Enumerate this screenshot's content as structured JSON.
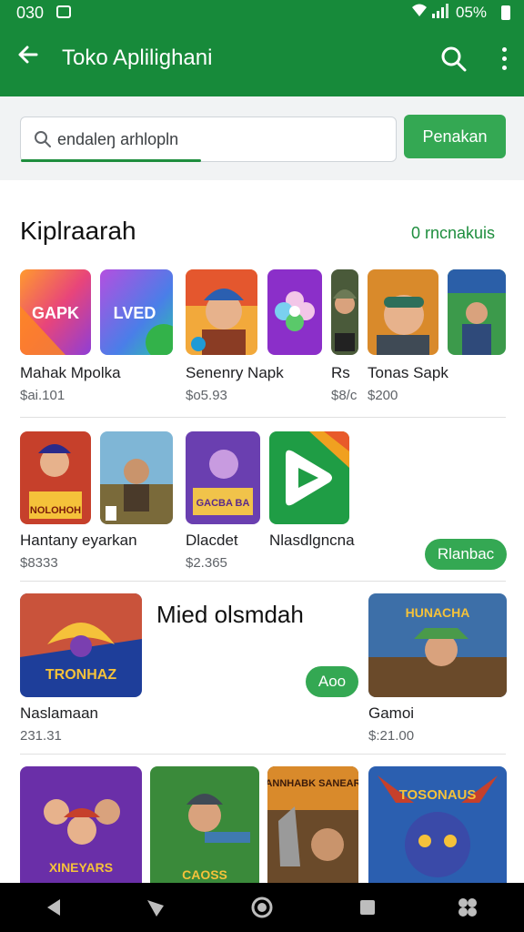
{
  "status_bar": {
    "time": "030",
    "battery_text": "05%"
  },
  "app_bar": {
    "title": "Toko Aplilighani"
  },
  "search": {
    "query": "endaleŋ arhlopln",
    "button_label": "Penakan"
  },
  "section": {
    "title": "Kiplraarah",
    "link": "0 rncnakuis"
  },
  "row1": [
    {
      "name": "Mahak Mpolka",
      "price": "$ai.101",
      "art": "gapk",
      "art_text": "GAPK"
    },
    {
      "name": "",
      "price": "",
      "art": "lved",
      "art_text": "LVED"
    },
    {
      "name": "Senenry Napk",
      "price": "$o5.93",
      "art": "hero-red"
    },
    {
      "name": "",
      "price": "",
      "art": "flower"
    },
    {
      "name": "Rs",
      "price": "$8/c",
      "art": "soldier-small"
    },
    {
      "name": "Tonas Sapk",
      "price": "$200",
      "art": "goggles"
    },
    {
      "name": "",
      "price": "",
      "art": "soldier-green"
    }
  ],
  "row2": [
    {
      "name": "Hantany eyarkan",
      "price": "$8333",
      "art": "fighter",
      "art_text": "NOLOHOH"
    },
    {
      "name": "",
      "price": "",
      "art": "warrior"
    },
    {
      "name": "Dlacdet",
      "price": "$2.365",
      "art": "purple-game",
      "art_text": "GACBA BA"
    },
    {
      "name": "Nlasdlgncna",
      "price": "",
      "art": "play"
    }
  ],
  "row2_button": "Rlanbac",
  "feature": {
    "title": "Mied olsmdah",
    "left": {
      "name": "Naslamaan",
      "price": "231.31",
      "art": "phoenix",
      "art_text": "TRONHAZ"
    },
    "button": "Aoo",
    "right": {
      "name": "Gamoi",
      "price": "$:21.00",
      "art": "elf",
      "art_text": "HUNACHA"
    }
  },
  "row4": [
    {
      "art": "crew",
      "art_text": "XINEYARS"
    },
    {
      "art": "jungle",
      "art_text": "CAOSS"
    },
    {
      "art": "ammbark",
      "art_text": "ANNHABK SANEAR"
    },
    {
      "art": "creature",
      "art_text": "TOSONAUS"
    }
  ],
  "colors": {
    "primary": "#178a3a",
    "accent": "#34a853",
    "link": "#1e8e3e"
  }
}
